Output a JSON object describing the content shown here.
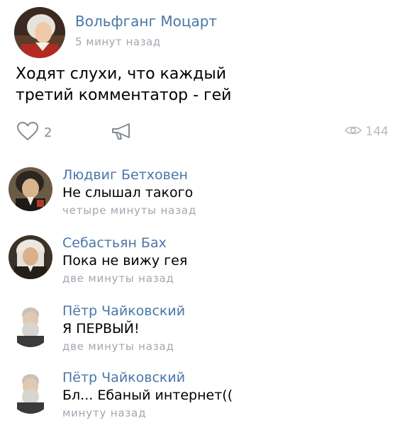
{
  "post": {
    "author": "Вольфганг Моцарт",
    "time": "5 минут назад",
    "text_lines": [
      "Ходят слухи, что каждый",
      "третий комментатор - гей"
    ],
    "likes": "2",
    "views": "144"
  },
  "comments": [
    {
      "author": "Людвиг Бетховен",
      "text": "Не слышал такого",
      "time": "четыре минуты назад",
      "avatar_icon": "beethoven-portrait"
    },
    {
      "author": "Себастьян Бах",
      "text": "Пока не вижу гея",
      "time": "две минуты назад",
      "avatar_icon": "bach-portrait"
    },
    {
      "author": "Пётр Чайковский",
      "text": "Я ПЕРВЫЙ!",
      "time": "две минуты назад",
      "avatar_icon": "tchaikovsky-portrait"
    },
    {
      "author": "Пётр Чайковский",
      "text": "Бл... Ебаный интернет((",
      "time": "минуту назад",
      "avatar_icon": "tchaikovsky-portrait"
    }
  ],
  "colors": {
    "link": "#4a76a8",
    "meta": "#a0a7b0",
    "icon": "#828a94"
  }
}
